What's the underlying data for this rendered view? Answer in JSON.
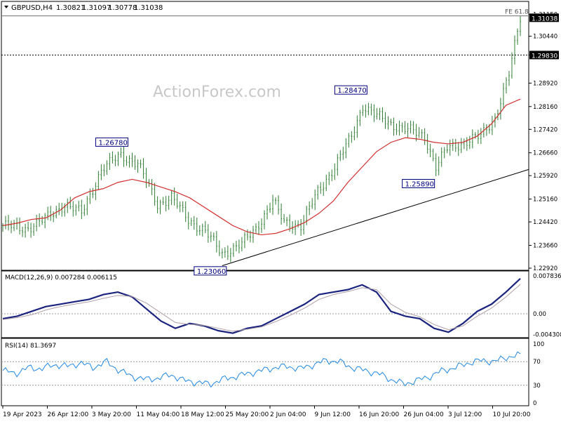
{
  "header": {
    "symbol": "GBPUSD,H4",
    "open": "1.30821",
    "high": "1.31097",
    "low": "1.30778",
    "close": "1.31038"
  },
  "watermark": "ActionForex.com",
  "colors": {
    "up_candle": "#2e7d32",
    "down_candle": "#2e7d32",
    "ma": "#d32f2f",
    "macd_main": "#1a237e",
    "macd_signal": "#b0a0a8",
    "rsi": "#1e88e5",
    "price_box": "#000000"
  },
  "chart_data": [
    {
      "type": "line",
      "title": "GBPUSD,H4",
      "ylim": [
        1.2292,
        1.3125
      ],
      "y_ticks": [
        "1.31150",
        "1.30440",
        "1.29830",
        "1.28920",
        "1.28160",
        "1.27420",
        "1.26660",
        "1.25920",
        "1.25160",
        "1.24420",
        "1.23660",
        "1.22920"
      ],
      "x_labels": [
        "19 Apr 2023",
        "26 Apr 12:00",
        "3 May 20:00",
        "11 May 04:00",
        "18 May 12:00",
        "25 May 20:00",
        "2 Jun 04:00",
        "9 Jun 12:00",
        "16 Jun 20:00",
        "26 Jun 04:00",
        "3 Jul 12:00",
        "10 Jul 20:00"
      ],
      "last_price": "1.31038",
      "level_line": "1.29830",
      "annotations": [
        {
          "text": "1.26780",
          "idx": 42
        },
        {
          "text": "1.23060",
          "idx": 78
        },
        {
          "text": "1.28470",
          "idx": 127
        },
        {
          "text": "1.25890",
          "idx": 152
        },
        {
          "text": "FE 61.8",
          "idx": 182
        }
      ],
      "close_anchors": [
        [
          0,
          1.243
        ],
        [
          8,
          1.242
        ],
        [
          15,
          1.245
        ],
        [
          22,
          1.25
        ],
        [
          28,
          1.247
        ],
        [
          35,
          1.261
        ],
        [
          42,
          1.266
        ],
        [
          48,
          1.263
        ],
        [
          55,
          1.25
        ],
        [
          60,
          1.252
        ],
        [
          66,
          1.245
        ],
        [
          72,
          1.241
        ],
        [
          78,
          1.234
        ],
        [
          85,
          1.237
        ],
        [
          90,
          1.242
        ],
        [
          96,
          1.251
        ],
        [
          100,
          1.244
        ],
        [
          106,
          1.243
        ],
        [
          112,
          1.254
        ],
        [
          118,
          1.262
        ],
        [
          124,
          1.272
        ],
        [
          128,
          1.282
        ],
        [
          132,
          1.279
        ],
        [
          138,
          1.276
        ],
        [
          144,
          1.274
        ],
        [
          150,
          1.272
        ],
        [
          154,
          1.262
        ],
        [
          158,
          1.268
        ],
        [
          164,
          1.27
        ],
        [
          170,
          1.272
        ],
        [
          175,
          1.278
        ],
        [
          180,
          1.292
        ],
        [
          184,
          1.3104
        ]
      ],
      "moving_average": [
        1.243,
        1.2438,
        1.245,
        1.2455,
        1.248,
        1.252,
        1.254,
        1.255,
        1.257,
        1.258,
        1.257,
        1.2555,
        1.254,
        1.252,
        1.249,
        1.246,
        1.243,
        1.241,
        1.24,
        1.2405,
        1.242,
        1.244,
        1.247,
        1.251,
        1.257,
        1.262,
        1.267,
        1.27,
        1.2715,
        1.271,
        1.27,
        1.2695,
        1.27,
        1.272,
        1.276,
        1.282,
        1.284
      ]
    },
    {
      "type": "line",
      "title": "MACD(12,26,9) 0.007284 0.006115",
      "y_ticks": [
        "0.007836",
        "0.00",
        "-0.004308"
      ],
      "ylim": [
        -0.0045,
        0.008
      ],
      "series": [
        {
          "name": "MACD",
          "values": [
            -0.001,
            -0.0005,
            0.0005,
            0.0015,
            0.002,
            0.0025,
            0.003,
            0.004,
            0.0045,
            0.0035,
            0.001,
            -0.0015,
            -0.003,
            -0.002,
            -0.0025,
            -0.0035,
            -0.004,
            -0.003,
            -0.0025,
            -0.001,
            0.0005,
            0.002,
            0.004,
            0.0045,
            0.005,
            0.006,
            0.0045,
            0.0005,
            -0.0005,
            -0.001,
            -0.003,
            -0.0038,
            -0.002,
            0.0005,
            0.002,
            0.0045,
            0.0073
          ]
        },
        {
          "name": "Signal",
          "values": [
            -0.0012,
            -0.0008,
            -0.0002,
            0.0008,
            0.0015,
            0.002,
            0.0025,
            0.0032,
            0.0038,
            0.0036,
            0.0022,
            0.0002,
            -0.0018,
            -0.0022,
            -0.0024,
            -0.003,
            -0.0036,
            -0.0032,
            -0.0027,
            -0.0016,
            -0.0003,
            0.0012,
            0.003,
            0.004,
            0.0046,
            0.0054,
            0.005,
            0.002,
            0.0003,
            -0.0006,
            -0.0022,
            -0.0033,
            -0.0025,
            -0.0005,
            0.0012,
            0.0035,
            0.0061
          ]
        }
      ]
    },
    {
      "type": "line",
      "title": "RSI(14) 81.3697",
      "y_ticks": [
        "100",
        "70",
        "30",
        "0"
      ],
      "ylim": [
        0,
        100
      ],
      "series": [
        {
          "name": "RSI",
          "values": [
            55,
            50,
            60,
            58,
            65,
            62,
            68,
            60,
            70,
            55,
            45,
            40,
            42,
            48,
            38,
            35,
            32,
            40,
            45,
            50,
            55,
            60,
            62,
            58,
            65,
            72,
            70,
            60,
            55,
            50,
            40,
            32,
            38,
            45,
            55,
            60,
            68,
            72,
            70,
            78,
            81
          ]
        }
      ]
    }
  ]
}
